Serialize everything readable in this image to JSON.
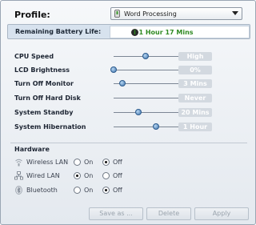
{
  "profile": {
    "label": "Profile:",
    "selected": "Word Processing"
  },
  "battery": {
    "label": "Remaining Battery Life:",
    "value": "~ 1 Hour 17 Mins"
  },
  "settings": [
    {
      "label": "CPU Speed",
      "value": "High",
      "slider_level": 0.45
    },
    {
      "label": "LCD Brightness",
      "value": "0%",
      "slider_level": 0.0
    },
    {
      "label": "Turn Off Monitor",
      "value": "3 Mins",
      "slider_level": 0.12
    },
    {
      "label": "Turn Off Hard Disk",
      "value": "Never",
      "slider_level": 1.0
    },
    {
      "label": "System Standby",
      "value": "20 Mins",
      "slider_level": 0.35
    },
    {
      "label": "System Hibernation",
      "value": "1 Hour",
      "slider_level": 0.6
    }
  ],
  "hardware": {
    "title": "Hardware",
    "on_label": "On",
    "off_label": "Off",
    "items": [
      {
        "label": "Wireless LAN",
        "icon": "wireless-icon",
        "state": "off"
      },
      {
        "label": "Wired LAN",
        "icon": "network-icon",
        "state": "on"
      },
      {
        "label": "Bluetooth",
        "icon": "bluetooth-icon",
        "state": "off"
      }
    ]
  },
  "buttons": {
    "save_as": "Save as ...",
    "delete": "Delete",
    "apply": "Apply"
  }
}
